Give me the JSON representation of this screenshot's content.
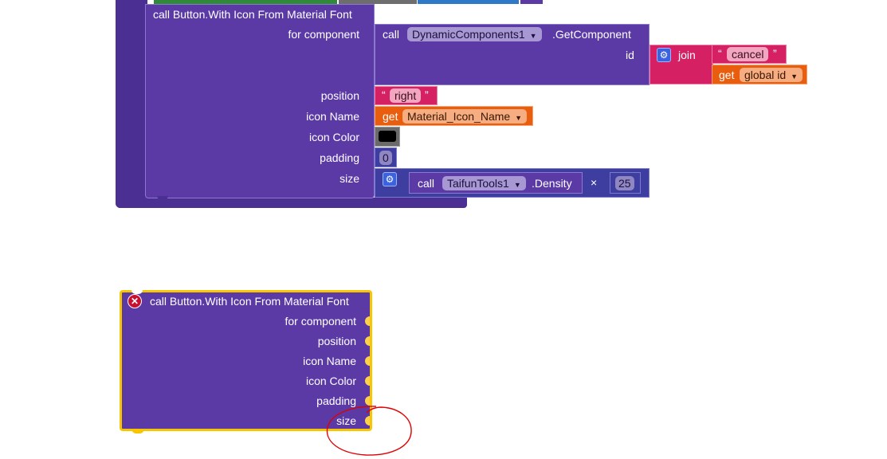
{
  "top_block": {
    "header": "call Button.With Icon From Material Font",
    "labels": {
      "for_component": "for component",
      "position": "position",
      "icon_name": "icon Name",
      "icon_color": "icon Color",
      "padding": "padding",
      "size": "size"
    },
    "get_component": {
      "call": "call",
      "component": "DynamicComponents1",
      "method": ".GetComponent",
      "id_label": "id"
    },
    "join": {
      "label": "join",
      "string_value": "cancel",
      "get_label": "get",
      "get_var": "global id"
    },
    "position_value": "right",
    "icon_name_get": "get",
    "icon_name_var": "Material_Icon_Name",
    "icon_color_value": "#000000",
    "padding_value": "0",
    "size_expr": {
      "call": "call",
      "component": "TaifunTools1",
      "method": ".Density",
      "operator": "×",
      "number": "25"
    }
  },
  "bottom_block": {
    "header": "call Button.With Icon From Material Font",
    "labels": {
      "for_component": "for component",
      "position": "position",
      "icon_name": "icon Name",
      "icon_color": "icon Color",
      "padding": "padding",
      "size": "size"
    },
    "error_icon": "error-x-icon",
    "highlight_color": "#f7c600",
    "annotation_color": "#e00000"
  },
  "colors": {
    "component_purple": "#5b3aa6",
    "text_pink": "#d52163",
    "variable_orange": "#e95d0f",
    "math_blue": "#3e3ea0"
  }
}
